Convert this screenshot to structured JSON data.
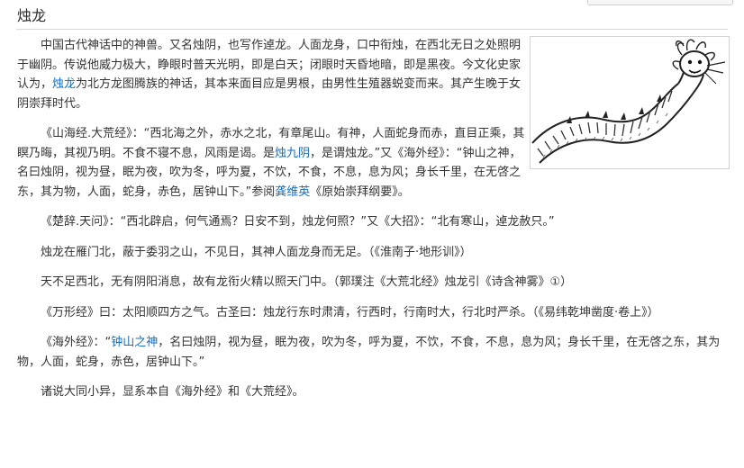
{
  "page": {
    "title": "烛龙"
  },
  "intro": {
    "text_before_link": "中国古代神话中的神兽。又名烛阴，也写作逴龙。人面龙身，口中衔烛，在西北无日之处照明于幽阴。传说他威力极大，睁眼时普天光明，即是白天；闭眼时天昏地暗，即是黑夜。今文化史家认为，",
    "link": "烛龙",
    "text_after_link": "为北方龙图腾族的神话，其本来面目应是男根，由男性生殖器蜕变而来。其产生晚于女阴崇拜时代。"
  },
  "para_shanhai": {
    "text_1": "《山海经.大荒经》：“西北海之外，赤水之北，有章尾山。有神，人面蛇身而赤，直目正乘，其瞑乃晦，其视乃明。不食不寝不息，风雨是谒。是",
    "link_1": "烛九阴",
    "text_2": "，是谓烛龙。”又《海外经》：“钟山之神，名曰烛阴，视为昼，眠为夜，吹为冬，呼为夏，不饮，不食，不息，息为风；身长千里，在无啓之东，其为物，人面，蛇身，赤色，居钟山下。”参阅",
    "link_2": "龚维英",
    "text_3": "《原始崇拜纲要》。"
  },
  "para_chuci": {
    "text": "《楚辞.天问》：“西北辟启，何气通焉？日安不到，烛龙何照？”又《大招》：“北有寒山，逴龙赦只。”"
  },
  "para_huainan": {
    "text": "烛龙在雁门北，蔽于委羽之山，不见日，其神人面龙身而无足。（《淮南子·地形训》）"
  },
  "para_guopu": {
    "text": "天不足西北，无有阴阳消息，故有龙衔火精以照天门中。（郭璞注《大荒北经》烛龙引《诗含神雾》①）"
  },
  "para_wanxing": {
    "text": "《万形经》曰：太阳顺四方之气。古圣曰：烛龙行东时肃清，行西时，行南时大，行北时严杀。（《易纬乾坤凿度·卷上》）"
  },
  "para_haiwai": {
    "text_1": "《海外经》：“",
    "link": "钟山之神",
    "text_2": "，名曰烛阴，视为昼，眠为夜，吹为冬，呼为夏，不饮，不食，不息，息为风；身长千里，在无啓之东，其为物，人面，蛇身，赤色，居钟山下。”"
  },
  "para_last": {
    "text": "诸说大同小异，显系本自《海外经》和《大荒经》。"
  },
  "figure": {
    "icon": "dragon-illustration"
  },
  "colors": {
    "link": "#136ec2",
    "text": "#333333"
  }
}
